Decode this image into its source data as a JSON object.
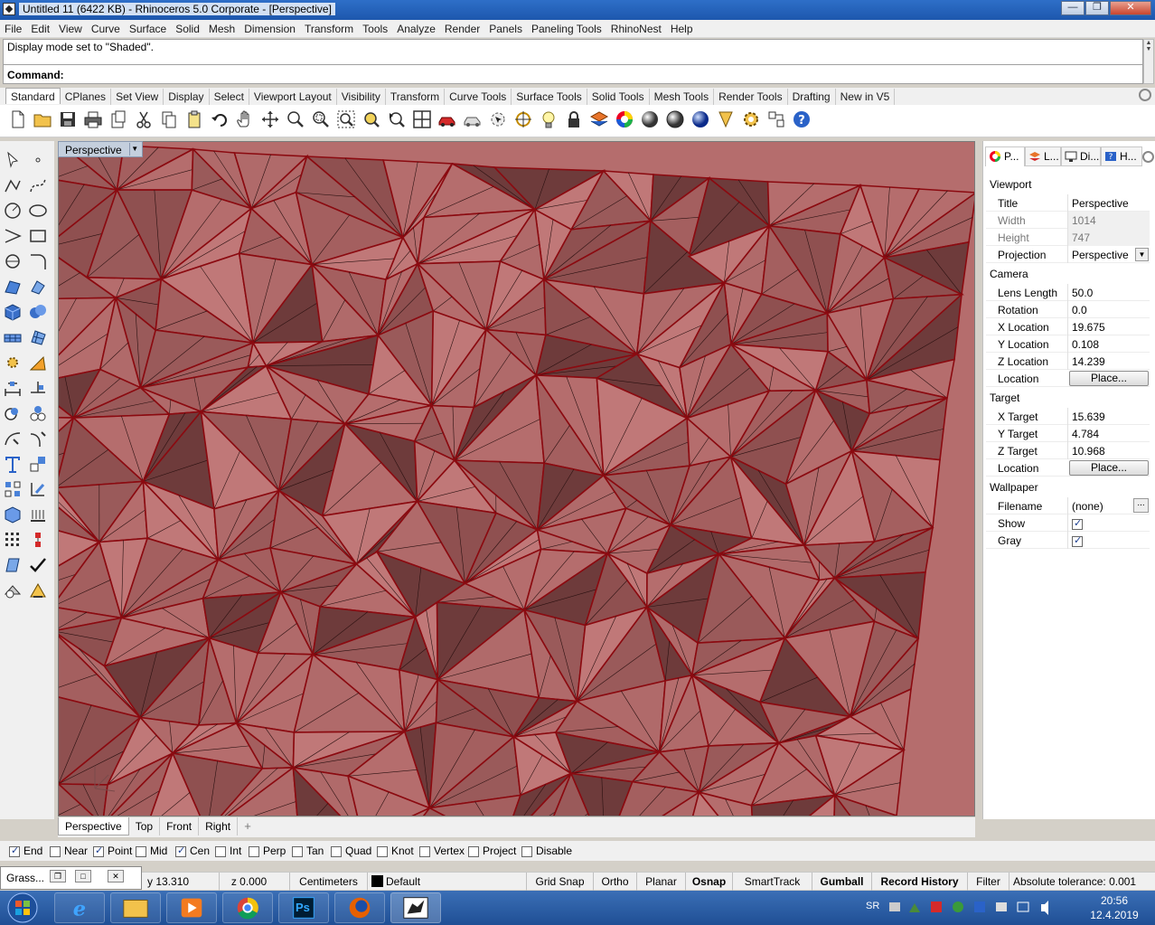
{
  "window": {
    "title": "Untitled 11 (6422 KB) - Rhinoceros  5.0 Corporate - [Perspective]",
    "min_glyph": "—",
    "max_glyph": "❐",
    "close_glyph": "✕"
  },
  "menu": [
    "File",
    "Edit",
    "View",
    "Curve",
    "Surface",
    "Solid",
    "Mesh",
    "Dimension",
    "Transform",
    "Tools",
    "Analyze",
    "Render",
    "Panels",
    "Paneling Tools",
    "RhinoNest",
    "Help"
  ],
  "command": {
    "history": "Display mode set to \"Shaded\".",
    "prompt": "Command:"
  },
  "toolbar_tabs": [
    "Standard",
    "CPlanes",
    "Set View",
    "Display",
    "Select",
    "Viewport Layout",
    "Visibility",
    "Transform",
    "Curve Tools",
    "Surface Tools",
    "Solid Tools",
    "Mesh Tools",
    "Render Tools",
    "Drafting",
    "New in V5"
  ],
  "viewport": {
    "title": "Perspective",
    "title_arrow": "▼",
    "tabs": [
      "Perspective",
      "Top",
      "Front",
      "Right"
    ],
    "add_tab": "+"
  },
  "properties": {
    "tabs": [
      "P...",
      "L...",
      "Di...",
      "H..."
    ],
    "sections": {
      "viewport": "Viewport",
      "camera": "Camera",
      "target": "Target",
      "wallpaper": "Wallpaper"
    },
    "viewport_rows": [
      {
        "label": "Title",
        "value": "Perspective"
      },
      {
        "label": "Width",
        "value": "1014"
      },
      {
        "label": "Height",
        "value": "747"
      },
      {
        "label": "Projection",
        "value": "Perspective"
      }
    ],
    "camera_rows": [
      {
        "label": "Lens Length",
        "value": "50.0"
      },
      {
        "label": "Rotation",
        "value": "0.0"
      },
      {
        "label": "X Location",
        "value": "19.675"
      },
      {
        "label": "Y Location",
        "value": "0.108"
      },
      {
        "label": "Z Location",
        "value": "14.239"
      },
      {
        "label": "Location",
        "value": "Place..."
      }
    ],
    "target_rows": [
      {
        "label": "X Target",
        "value": "15.639"
      },
      {
        "label": "Y Target",
        "value": "4.784"
      },
      {
        "label": "Z Target",
        "value": "10.968"
      },
      {
        "label": "Location",
        "value": "Place..."
      }
    ],
    "wallpaper_rows": [
      {
        "label": "Filename",
        "value": "(none)"
      },
      {
        "label": "Show",
        "value": ""
      },
      {
        "label": "Gray",
        "value": ""
      }
    ],
    "filename_button": "..."
  },
  "osnap": [
    {
      "label": "End",
      "checked": true
    },
    {
      "label": "Near",
      "checked": false
    },
    {
      "label": "Point",
      "checked": true
    },
    {
      "label": "Mid",
      "checked": false
    },
    {
      "label": "Cen",
      "checked": true
    },
    {
      "label": "Int",
      "checked": false
    },
    {
      "label": "Perp",
      "checked": false
    },
    {
      "label": "Tan",
      "checked": false
    },
    {
      "label": "Quad",
      "checked": false
    },
    {
      "label": "Knot",
      "checked": false
    },
    {
      "label": "Vertex",
      "checked": false
    },
    {
      "label": "Project",
      "checked": false
    },
    {
      "label": "Disable",
      "checked": false
    }
  ],
  "grasshopper": {
    "label": "Grass..."
  },
  "status": {
    "y": "y 13.310",
    "z": "z 0.000",
    "units": "Centimeters",
    "layer": "Default",
    "grid_snap": "Grid Snap",
    "ortho": "Ortho",
    "planar": "Planar",
    "osnap": "Osnap",
    "smarttrack": "SmartTrack",
    "gumball": "Gumball",
    "record_history": "Record History",
    "filter": "Filter",
    "tolerance": "Absolute tolerance: 0.001"
  },
  "taskbar": {
    "lang": "SR",
    "time": "20:56",
    "date": "12.4.2019",
    "ps_label": "Ps"
  },
  "colors": {
    "mesh_fill": "#b56d6d",
    "mesh_edge": "#8b0a10",
    "taskbar": "#2a5ea8"
  }
}
